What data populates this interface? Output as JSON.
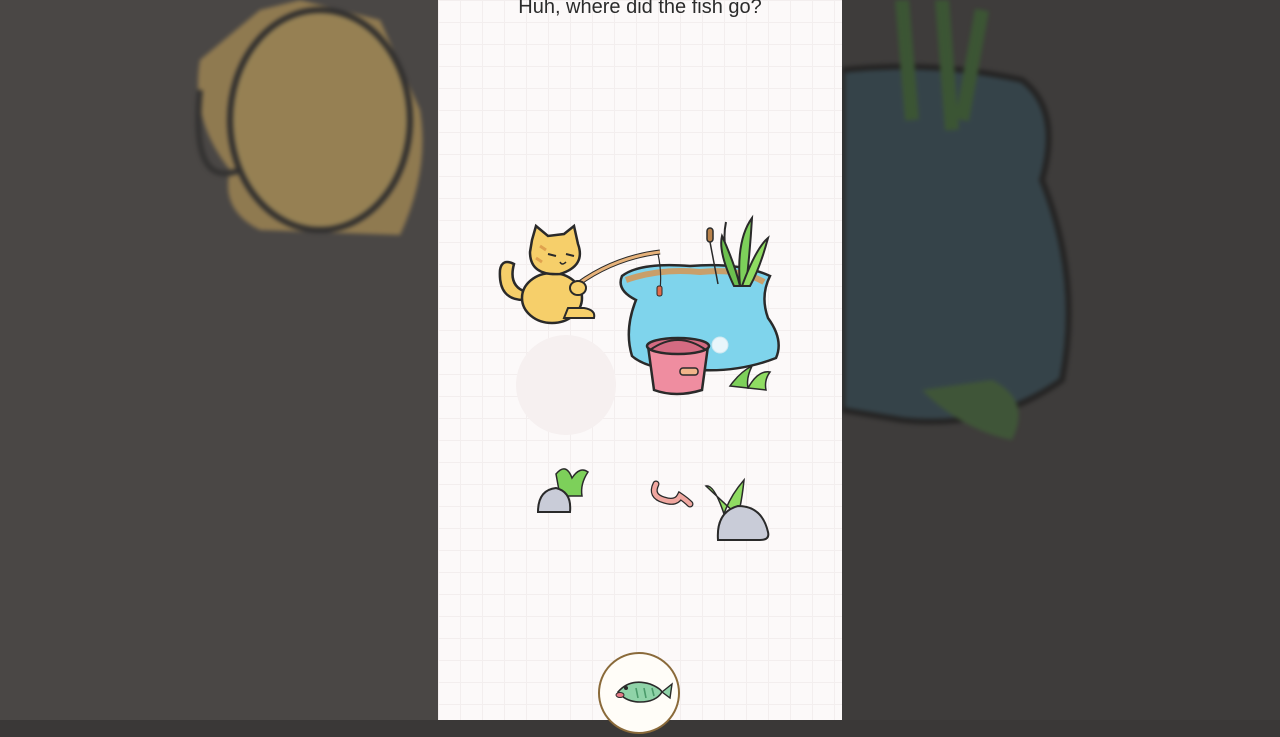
{
  "game": {
    "question": "Huh, where did the fish go?",
    "hint_icon": "fish-icon"
  },
  "scene": {
    "characters": [
      "cat"
    ],
    "objects": [
      "fishing-rod",
      "pond",
      "bucket",
      "reeds",
      "worm",
      "rock",
      "rock",
      "grass"
    ]
  }
}
